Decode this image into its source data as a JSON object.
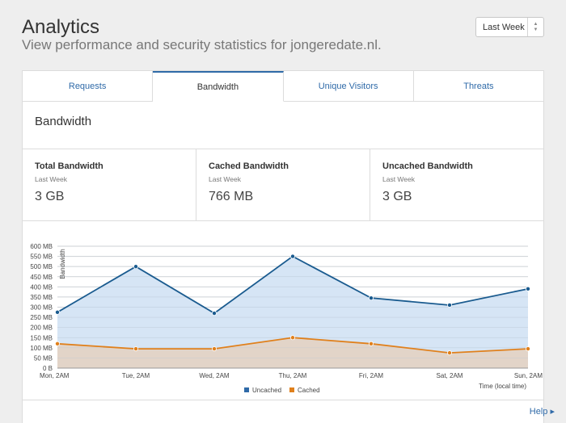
{
  "header": {
    "title": "Analytics",
    "subtitle": "View performance and security statistics for jongeredate.nl."
  },
  "range_select": {
    "value": "Last Week"
  },
  "tabs": [
    {
      "label": "Requests"
    },
    {
      "label": "Bandwidth"
    },
    {
      "label": "Unique Visitors"
    },
    {
      "label": "Threats"
    }
  ],
  "section": {
    "title": "Bandwidth"
  },
  "stats": [
    {
      "title": "Total Bandwidth",
      "period": "Last Week",
      "value": "3 GB"
    },
    {
      "title": "Cached Bandwidth",
      "period": "Last Week",
      "value": "766 MB"
    },
    {
      "title": "Uncached Bandwidth",
      "period": "Last Week",
      "value": "3 GB"
    }
  ],
  "chart_data": {
    "type": "area",
    "ylabel": "Bandwidth",
    "xlabel": "Time (local time)",
    "categories": [
      "Mon, 2AM",
      "Tue, 2AM",
      "Wed, 2AM",
      "Thu, 2AM",
      "Fri, 2AM",
      "Sat, 2AM",
      "Sun, 2AM"
    ],
    "y_ticks": [
      "0 B",
      "50 MB",
      "100 MB",
      "150 MB",
      "200 MB",
      "250 MB",
      "300 MB",
      "350 MB",
      "400 MB",
      "450 MB",
      "500 MB",
      "550 MB",
      "600 MB"
    ],
    "ylim": [
      0,
      600
    ],
    "grid": true,
    "legend_position": "bottom-center",
    "series": [
      {
        "name": "Uncached",
        "color": "#1a5b8f",
        "fill": "#cfe1f3",
        "values": [
          275,
          500,
          270,
          550,
          345,
          310,
          390
        ]
      },
      {
        "name": "Cached",
        "color": "#e0801c",
        "fill": "#e2d4c8",
        "values": [
          120,
          95,
          95,
          150,
          120,
          75,
          95
        ]
      }
    ]
  },
  "footer": {
    "help_label": "Help ▸"
  }
}
